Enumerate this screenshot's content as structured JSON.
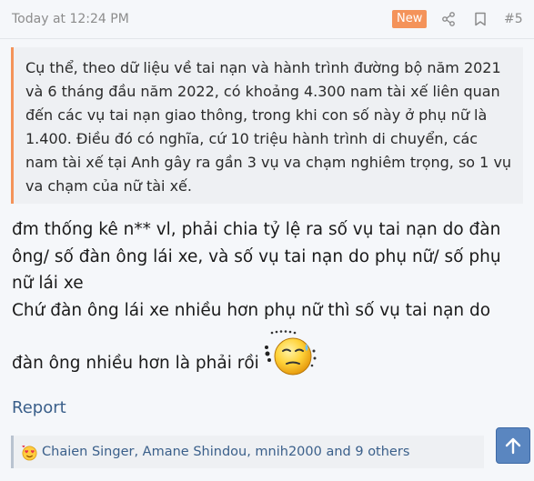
{
  "post": {
    "time": "Today at 12:24 PM",
    "new_badge": "New",
    "number": "#5",
    "icons": {
      "share": "share-icon",
      "bookmark": "bookmark-icon"
    }
  },
  "quote": {
    "text": "Cụ thể, theo dữ liệu về tai nạn và hành trình đường bộ năm 2021 và 6 tháng đầu năm 2022, có khoảng 4.300 nam tài xế liên quan đến các vụ tai nạn giao thông, trong khi con số này ở phụ nữ là 1.400. Điều đó có nghĩa, cứ 10 triệu hành trình di chuyển, các nam tài xế tại Anh gây ra gần 3 vụ va chạm nghiêm trọng, so 1 vụ va chạm của nữ tài xế."
  },
  "message": {
    "paragraph1": "đm thống kê n** vl, phải chia tỷ lệ ra số vụ tai nạn do đàn ông/ số đàn ông lái xe, và số vụ tai nạn do phụ nữ/ số phụ nữ lái xe",
    "paragraph2": "Chứ đàn ông lái xe nhiều hơn phụ nữ thì số vụ tai nạn do",
    "paragraph3": "đàn ông nhiều hơn là phải rồi",
    "emoji": "sweating-smiley-icon"
  },
  "actions": {
    "report": "Report"
  },
  "reactions": {
    "text": "Chaien Singer, Amane Shindou, mnih2000 and 9 others",
    "icon": "love-reaction-icon"
  },
  "scroll_top": {
    "icon": "arrow-up-icon"
  },
  "colors": {
    "accent": "#f4935a",
    "link": "#3a5f8a",
    "scroll_button": "#5a86c0"
  }
}
